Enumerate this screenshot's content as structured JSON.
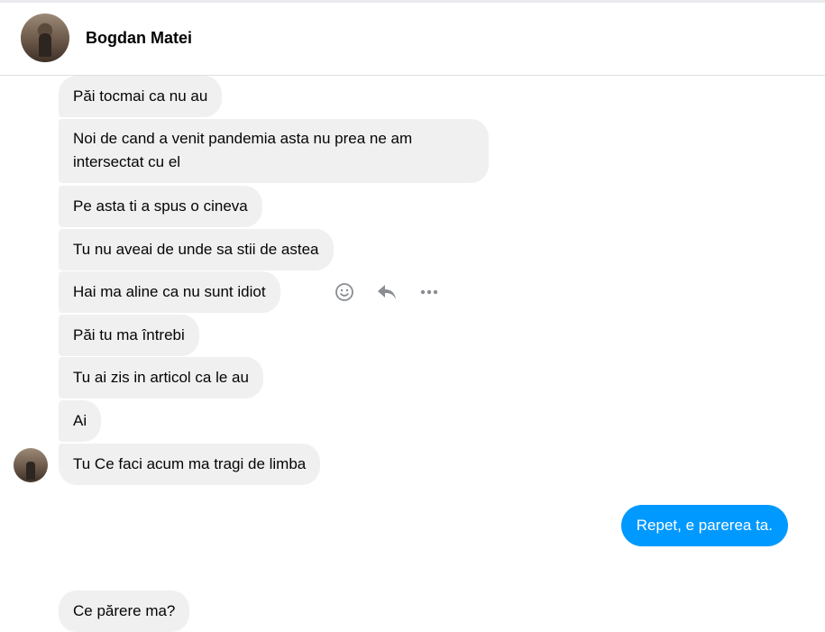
{
  "header": {
    "name": "Bogdan Matei"
  },
  "messages_in": [
    "Păi tocmai ca nu au",
    "Noi de cand a venit pandemia asta nu prea ne am intersectat cu el",
    "Pe asta ti a spus o cineva",
    "Tu nu aveai de unde sa stii de astea",
    "Hai ma aline ca nu sunt idiot",
    "Păi tu ma întrebi",
    "Tu ai zis in articol ca le au",
    "Ai",
    "Tu Ce faci acum ma tragi de limba"
  ],
  "message_out": "Repet, e parerea ta.",
  "message_in_last": "Ce părere ma?",
  "hover_actions": [
    "react-icon",
    "reply-icon",
    "more-icon"
  ],
  "colors": {
    "incoming_bg": "#f0f0f0",
    "outgoing_bg": "#0099ff",
    "outgoing_text": "#ffffff",
    "icon": "#8a8d91"
  }
}
